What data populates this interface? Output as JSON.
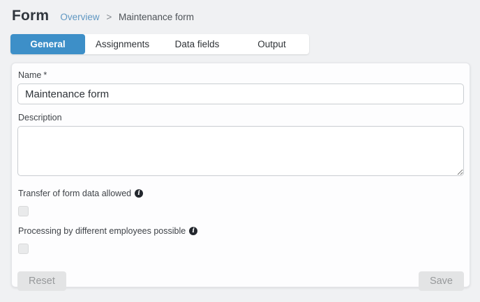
{
  "header": {
    "title": "Form",
    "breadcrumb": {
      "link": "Overview",
      "separator": ">",
      "current": "Maintenance form"
    }
  },
  "tabs": [
    {
      "label": "General",
      "active": true
    },
    {
      "label": "Assignments",
      "active": false
    },
    {
      "label": "Data fields",
      "active": false
    },
    {
      "label": "Output",
      "active": false
    }
  ],
  "form": {
    "name": {
      "label": "Name",
      "required_marker": "*",
      "value": "Maintenance form"
    },
    "description": {
      "label": "Description",
      "value": ""
    },
    "transfer_checkbox": {
      "label": "Transfer of form data allowed",
      "info_icon": "i",
      "checked": false
    },
    "processing_checkbox": {
      "label": "Processing by different employees possible",
      "info_icon": "i",
      "checked": false
    },
    "buttons": {
      "reset": "Reset",
      "save": "Save"
    }
  },
  "colors": {
    "accent_blue": "#3d8fc8",
    "link_blue": "#5f97c2",
    "page_background": "#f0f1f3",
    "info_icon_dark": "#23272d"
  }
}
